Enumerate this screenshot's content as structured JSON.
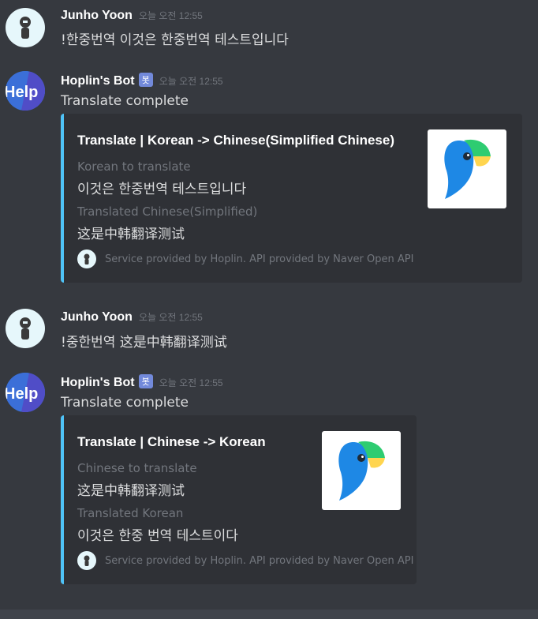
{
  "messages": [
    {
      "author": "Junho Yoon",
      "timestamp": "오늘 오전 12:55",
      "text": "!한중번역 이것은 한중번역 테스트입니다"
    },
    {
      "author": "Hoplin's Bot",
      "bot_tag": "봇",
      "timestamp": "오늘 오전 12:55",
      "text": "Translate complete",
      "embed": {
        "title": "Translate | Korean -> Chinese(Simplified Chinese)",
        "fields": [
          {
            "name": "Korean to translate",
            "value": "이것은 한중번역 테스트입니다"
          },
          {
            "name": "Translated Chinese(Simplified)",
            "value": "这是中韩翻译测试"
          }
        ],
        "footer": "Service provided by Hoplin. API provided by Naver Open API"
      }
    },
    {
      "author": "Junho Yoon",
      "timestamp": "오늘 오전 12:55",
      "text": "!중한번역 这是中韩翻译测试"
    },
    {
      "author": "Hoplin's Bot",
      "bot_tag": "봇",
      "timestamp": "오늘 오전 12:55",
      "text": "Translate complete",
      "embed": {
        "title": "Translate | Chinese -> Korean",
        "fields": [
          {
            "name": "Chinese to translate",
            "value": "这是中韩翻译测试"
          },
          {
            "name": "Translated Korean",
            "value": "이것은 한중 번역 테스트이다"
          }
        ],
        "footer": "Service provided by Hoplin. API provided by Naver Open API"
      }
    }
  ],
  "bot_avatar_text": "Help",
  "colors": {
    "background": "#36393f",
    "embed_bg": "#2f3136",
    "embed_accent": "#4fc3f7",
    "bot_tag": "#7289da",
    "papago_blue": "#1e88e5",
    "papago_green": "#2ecc71"
  },
  "icons": {
    "user_avatar": "person-avatar-icon",
    "bot_avatar": "help-logo-icon",
    "embed_thumbnail": "papago-parrot-icon",
    "footer_icon": "person-avatar-icon"
  }
}
